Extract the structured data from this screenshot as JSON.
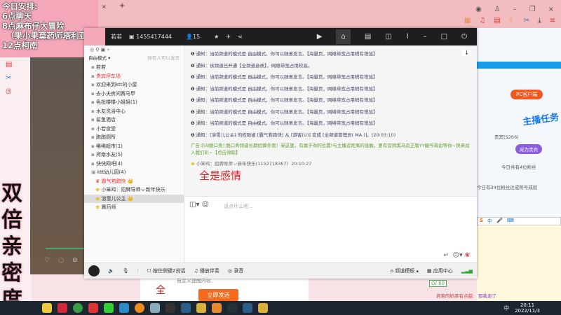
{
  "overlay": {
    "schedule": [
      "今日安排:",
      "6点聊天",
      "8点麻布仔大冒险",
      "（果小果莫药师塔利亚)",
      "12点柯南"
    ],
    "banner": "双倍亲密度"
  },
  "browser": {
    "window_controls": [
      "skin",
      "minimize",
      "maximize",
      "close"
    ]
  },
  "yy": {
    "user": "若若",
    "channel_id": "1455417444",
    "online": "15",
    "list_header": {
      "mode": "自由模式",
      "hint": "所有人可以发言"
    },
    "channels": [
      {
        "label": "若若"
      },
      {
        "label": "贵宾停车场",
        "red": true
      },
      {
        "label": "欢迎来到ktt的小屋"
      },
      {
        "label": "去小夫房间赛马甲"
      },
      {
        "label": "色批楼楼小姐姐(1)"
      },
      {
        "label": "水友洗浴中心"
      },
      {
        "label": "鲨鱼酒店"
      },
      {
        "label": "小若食堂"
      },
      {
        "label": "跑跑厕所"
      },
      {
        "label": "稀稀超市(1)"
      },
      {
        "label": "柯南水友(5)"
      },
      {
        "label": "快快网吧(4)"
      },
      {
        "label": "ktt幼儿园(4)"
      }
    ],
    "members": [
      "霸气若跑快",
      "小笨鸡：招牌导师·ᵤ·新年快乐",
      "溶雪儿公主",
      "冀药师"
    ],
    "notices": [
      "通知：当前频道的模式是 自由模式，你可以随意发言。【海量页，网络带宽占用稍有增加】",
      "通知：该频道已开通【全频道音质】，网络带宽占用较高。",
      "通知：当前频道的模式是 自由模式，你可以随意发言。【海量页，网络带宽占用稍有增加】",
      "通知：当前频道的模式是 自由模式，你可以随意发言。【海量页，网络带宽占用稍有增加】",
      "通知：当前频道的模式是 自由模式，你可以随意发言。【海量页，网络带宽占用稍有增加】",
      "通知：当前频道的模式是 自由模式，你可以随意发言。【海量页，网络带宽占用稍有增加】",
      "通知：当前频道的模式是 自由模式，你可以随意发言。【海量页，网络带宽占用稍有增加】",
      "通知：[溶雪儿公主] 的权限被 [霸气若跑快] 从 [游客(U)] 变成 [全频道管理员( MA )]。(20:03:10)"
    ],
    "ad": "广告:[59脱口秀] 脱口秀频道长期招募外管！来这里，有属于你的位置!与主播近距离的接触，更有官频黑马及正版YY靓号周边等你~快来加入我们叭~【点击领取】",
    "chat_author": "小笨鸡：招牌导师·ᵤ·新年快乐(1152718367)",
    "chat_time": "20:10:27",
    "chat_text": "全是感情",
    "input_placeholder": "说点什么吧...",
    "toolbar": {
      "ptt": "按住侧键2说话",
      "music": "播放伴奏",
      "record": "录音",
      "template": "频道模板",
      "apps": "应用中心"
    }
  },
  "page": {
    "pc_client": "PC客户端",
    "task": "主播任务",
    "tab_vip": "贵宾(5266)",
    "become": "成为贵宾",
    "fans_today": "今日共有4位粉丝",
    "fans_line": "今日有34位粉丝达成称号成就",
    "custom_tip": "自定义提醒内容",
    "send": "立即发送",
    "level": "LV 60",
    "bottom_msg": "若若的奶茶有点甜:",
    "bottom_msg2": "那我走了",
    "side_char": "全"
  },
  "taskbar": {
    "time": "20:11",
    "date": "2022/11/3",
    "ime": "中"
  }
}
